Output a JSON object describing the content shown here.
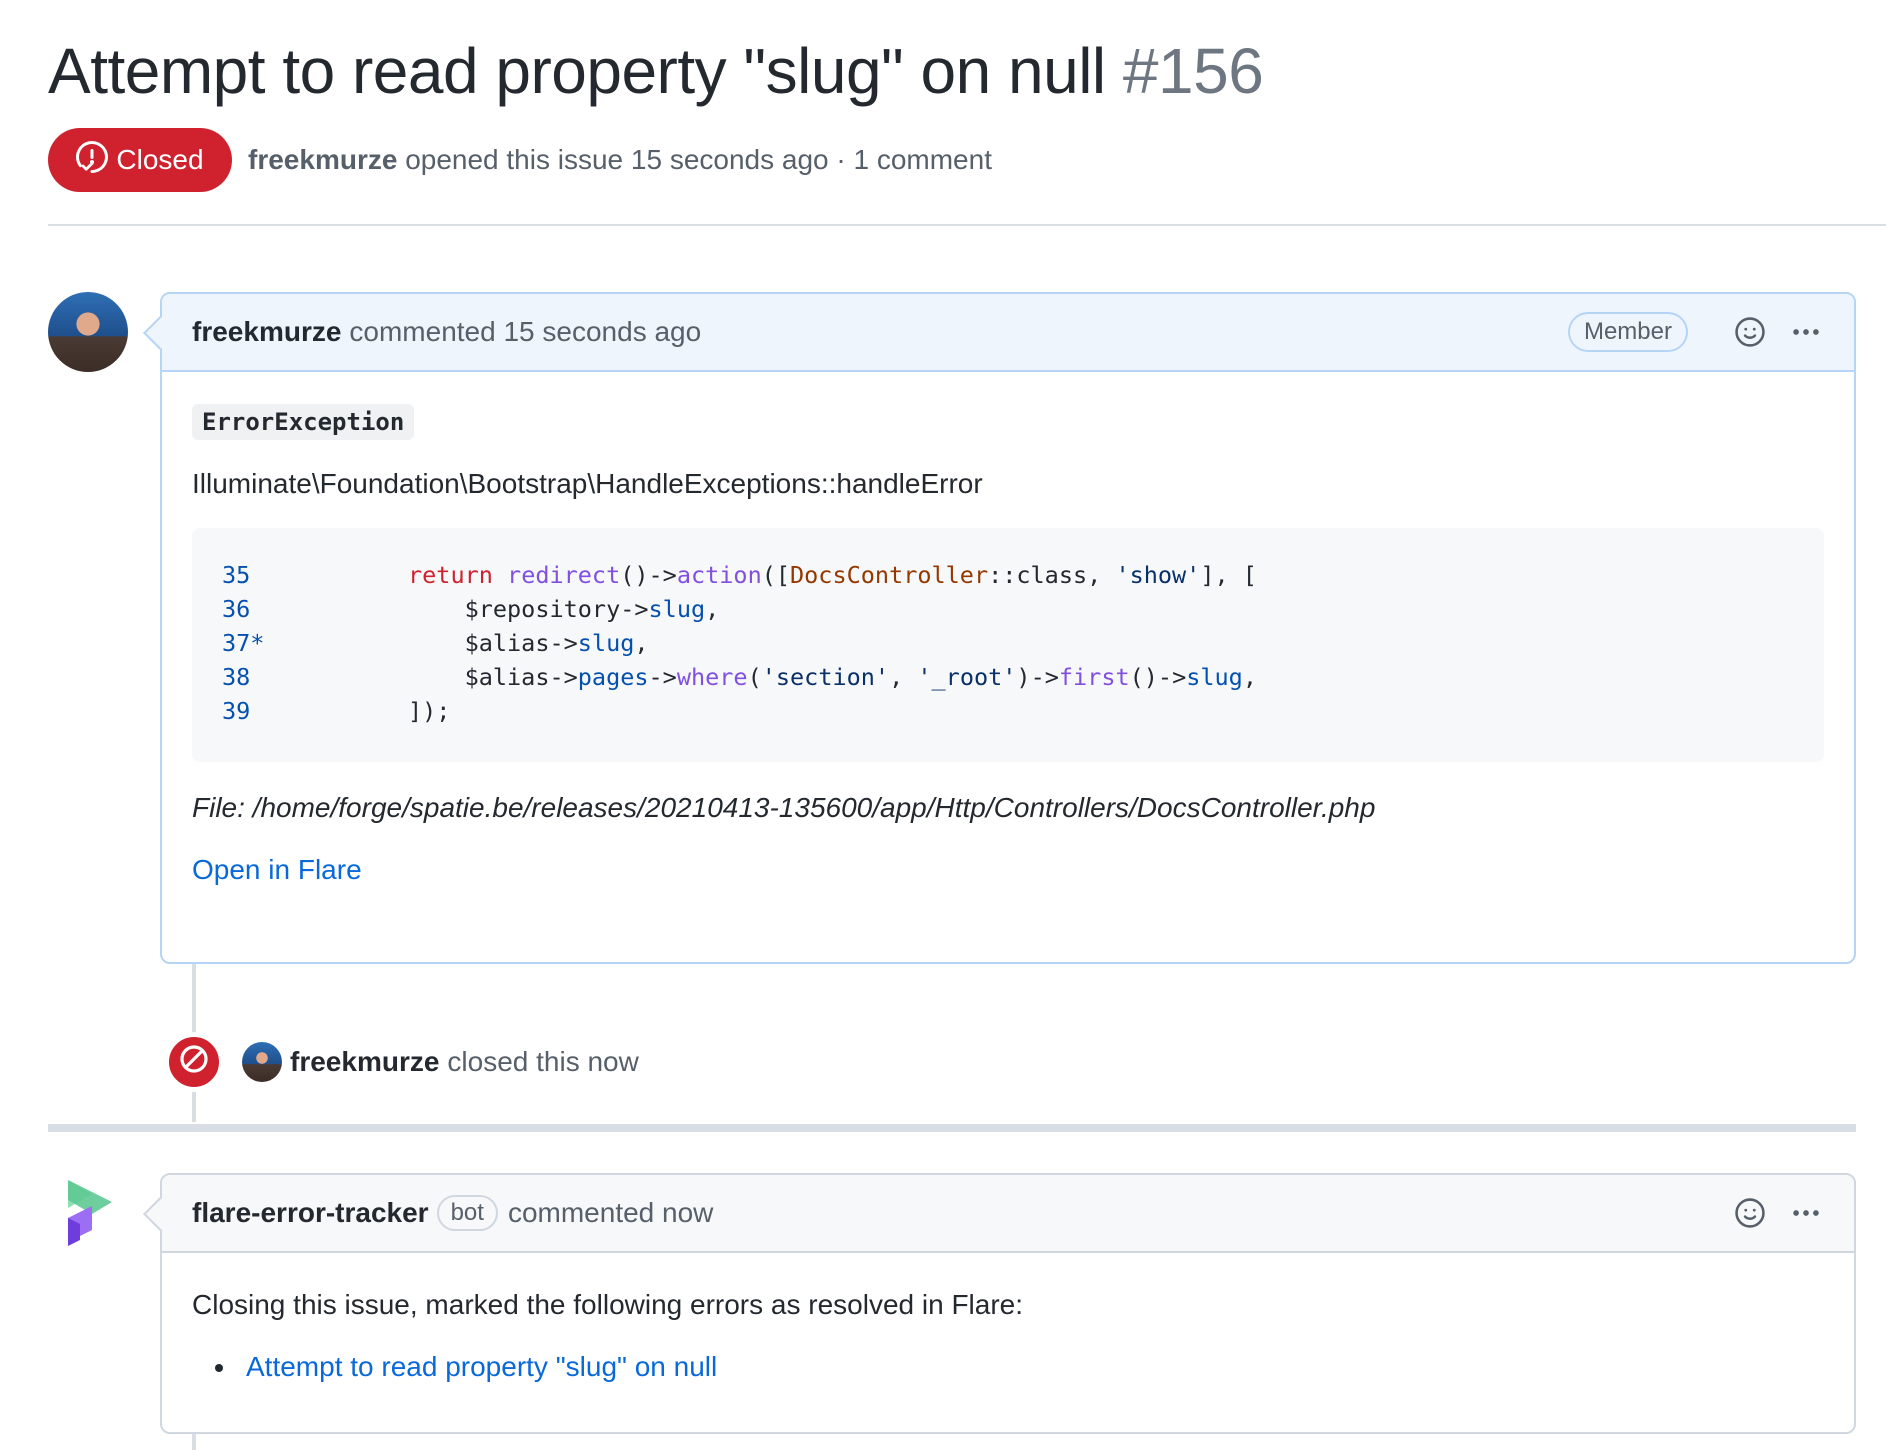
{
  "issue": {
    "title": "Attempt to read property \"slug\" on null",
    "number": "#156",
    "state": "Closed",
    "author": "freekmurze",
    "opened_text": "opened this issue 15 seconds ago · 1 comment"
  },
  "comment1": {
    "author": "freekmurze",
    "action": "commented 15 seconds ago",
    "role": "Member",
    "exception": "ErrorException",
    "handler": "Illuminate\\Foundation\\Bootstrap\\HandleExceptions::handleError",
    "file": "File: /home/forge/spatie.be/releases/20210413-135600/app/Http/Controllers/DocsController.php",
    "link": "Open in Flare"
  },
  "code": {
    "line_numbers": [
      "35",
      "36",
      "37*",
      "38",
      "39"
    ]
  },
  "event": {
    "author": "freekmurze",
    "text": "closed this now"
  },
  "comment2": {
    "author": "flare-error-tracker",
    "badge": "bot",
    "action": "commented now",
    "body": "Closing this issue, marked the following errors as resolved in Flare:",
    "items": [
      "Attempt to read property \"slug\" on null"
    ]
  },
  "icons": {
    "state": "issue-closed-icon",
    "reaction": "smiley-icon",
    "menu": "kebab-horizontal-icon",
    "event": "circle-slash-icon"
  },
  "colors": {
    "closed_red": "#cf222e",
    "link_blue": "#0969da",
    "member_header_bg": "#eef5fd"
  }
}
